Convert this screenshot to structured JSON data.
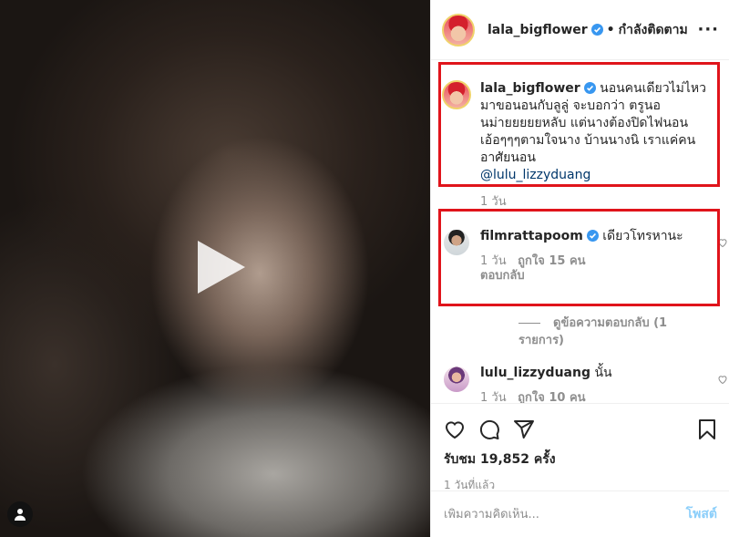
{
  "header": {
    "username": "lala_bigflower",
    "separator": "•",
    "follow_status": "กำลังติดตาม",
    "more": "···"
  },
  "caption": {
    "username": "lala_bigflower",
    "text": "นอนคนเดียวไม่ไหว มาขอนอนกับลูลู่ จะบอกว่า ตรูนอนม่ายยยยยหลับ แต่นางต้องปิดไฟนอน เอ้อๆๆๆตามใจนาง บ้านนางนิ เราแค่คนอาศัยนอน",
    "mention": "@lulu_lizzyduang",
    "time": "1 วัน"
  },
  "comments": [
    {
      "username": "filmrattapoom",
      "text": "เดียวโทรหานะ",
      "time": "1 วัน",
      "likes": "ถูกใจ 15 คน",
      "reply": "ตอบกลับ",
      "view_replies": "ดูข้อความตอบกลับ (1 รายการ)"
    },
    {
      "username": "lulu_lizzyduang",
      "text": "นั้น",
      "time": "1 วัน",
      "likes": "ถูกใจ 10 คน"
    }
  ],
  "stats": {
    "views": "รับชม 19,852 ครั้ง",
    "date": "1 วันที่แล้ว"
  },
  "add_comment": {
    "placeholder": "เพิ่มความคิดเห็น...",
    "post_label": "โพสต์"
  },
  "colors": {
    "verified": "#3897f0",
    "highlight_box": "#e0141b",
    "link": "#00376b",
    "post_button": "#0095f6"
  },
  "icons": [
    "play-icon",
    "user-tag-icon",
    "verified-icon",
    "more-icon",
    "heart-icon",
    "comment-icon",
    "share-icon",
    "bookmark-icon"
  ]
}
